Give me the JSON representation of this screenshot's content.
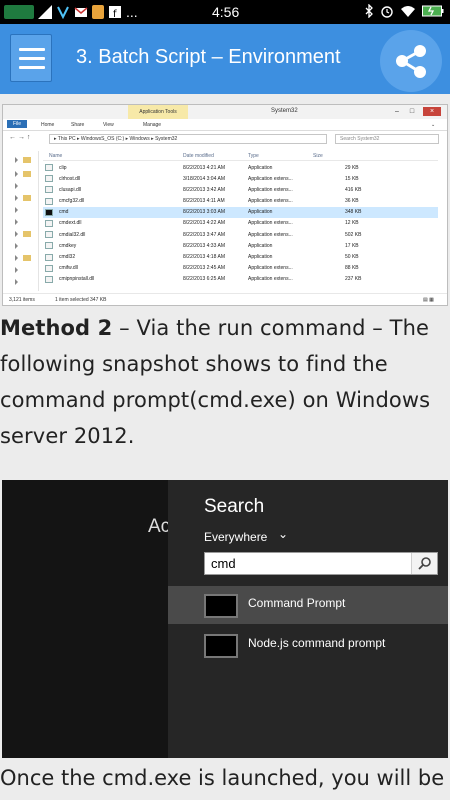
{
  "status_bar": {
    "time": "4:56",
    "left_icons": [
      "operator-logo-icon",
      "signal-icon",
      "network-icon",
      "gmail-icon",
      "notification-icon",
      "facebook-icon",
      "more-icon"
    ],
    "right_icons": [
      "bluetooth-icon",
      "alarm-icon",
      "wifi-icon",
      "battery-icon"
    ]
  },
  "app_bar": {
    "title": "3. Batch Script – Environment",
    "accent": "#3d8fe0"
  },
  "explorer": {
    "app_tools": "Application Tools",
    "window_title": "System32",
    "ribbon_tabs": [
      "File",
      "Home",
      "Share",
      "View",
      "Manage"
    ],
    "address": "▸ This PC ▸ WindowsS_OS (C:) ▸ Windows ▸ System32",
    "search_placeholder": "Search System32",
    "columns": [
      "Name",
      "Date modified",
      "Type",
      "Size"
    ],
    "rows": [
      [
        "clip",
        "8/22/2013 4:21 AM",
        "Application",
        "29 KB"
      ],
      [
        "clrhost.dll",
        "3/18/2014 3:04 AM",
        "Application extens...",
        "15 KB"
      ],
      [
        "clusapi.dll",
        "8/22/2013 3:42 AM",
        "Application extens...",
        "416 KB"
      ],
      [
        "cmcfg32.dll",
        "8/22/2013 4:11 AM",
        "Application extens...",
        "36 KB"
      ],
      [
        "cmd",
        "8/22/2013 3:03 AM",
        "Application",
        "348 KB"
      ],
      [
        "cmdext.dll",
        "8/22/2013 4:22 AM",
        "Application extens...",
        "12 KB"
      ],
      [
        "cmdial32.dll",
        "8/22/2013 3:47 AM",
        "Application extens...",
        "502 KB"
      ],
      [
        "cmdkey",
        "8/22/2013 4:33 AM",
        "Application",
        "17 KB"
      ],
      [
        "cmdl32",
        "8/22/2013 4:18 AM",
        "Application",
        "50 KB"
      ],
      [
        "cmifw.dll",
        "8/22/2013 2:45 AM",
        "Application extens...",
        "88 KB"
      ],
      [
        "cmipnpinstall.dll",
        "8/22/2013 6:25 AM",
        "Application extens...",
        "237 KB"
      ]
    ],
    "status_items": "3,121 items",
    "status_selected": "1 item selected 347 KB"
  },
  "method_paragraph": {
    "bold": "Method 2",
    "text": " – Via the run command – The following snapshot shows to find the command prompt(cmd.exe) on Windows server 2012."
  },
  "search_screen": {
    "left_text": "Ac",
    "title": "Search",
    "scope": "Everywhere",
    "query": "cmd",
    "results": [
      "Command Prompt",
      "Node.js command prompt"
    ]
  },
  "closing_paragraph": "Once the cmd.exe is launched, you will be"
}
